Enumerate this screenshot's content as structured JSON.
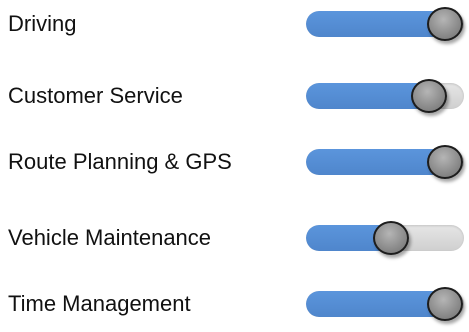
{
  "skills": [
    {
      "label": "Driving",
      "level": 1.0
    },
    {
      "label": "Customer Service",
      "level": 0.87
    },
    {
      "label": "Route Planning & GPS",
      "level": 1.0
    },
    {
      "label": "Vehicle Maintenance",
      "level": 0.55
    },
    {
      "label": "Time Management",
      "level": 1.0
    }
  ],
  "colors": {
    "fill": "#4f86cc",
    "track": "#d9d9d9",
    "knob": "#8e8e8e",
    "text": "#111111"
  }
}
